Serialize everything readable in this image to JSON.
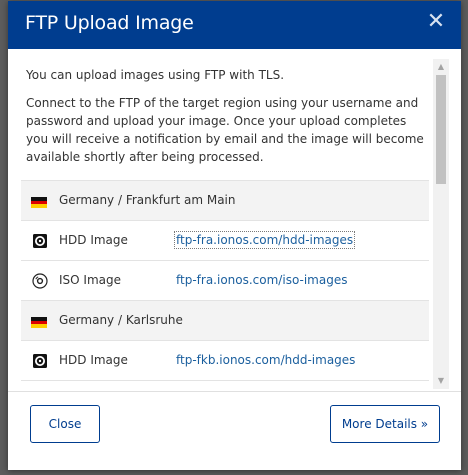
{
  "modal": {
    "title": "FTP Upload Image",
    "close_icon": "close-icon"
  },
  "body": {
    "intro": "You can upload images using FTP with TLS.",
    "description": "Connect to the FTP of the target region using your username and password and upload your image. Once your upload completes you will receive a notification by email and the image will become available shortly after being processed."
  },
  "regions": [
    {
      "name": "Germany / Frankfurt am Main",
      "flag": "germany-flag",
      "entries": [
        {
          "type_label": "HDD Image",
          "icon": "hdd-image-icon",
          "url": "ftp-fra.ionos.com/hdd-images",
          "focused": true
        },
        {
          "type_label": "ISO Image",
          "icon": "iso-image-icon",
          "url": "ftp-fra.ionos.com/iso-images",
          "focused": false
        }
      ]
    },
    {
      "name": "Germany / Karlsruhe",
      "flag": "germany-flag",
      "entries": [
        {
          "type_label": "HDD Image",
          "icon": "hdd-image-icon",
          "url": "ftp-fkb.ionos.com/hdd-images",
          "focused": false
        },
        {
          "type_label": "",
          "icon": "iso-image-icon",
          "url": "",
          "focused": false
        }
      ]
    }
  ],
  "scrollbar": {
    "up_icon": "scroll-up-arrow-icon",
    "down_icon": "scroll-down-arrow-icon"
  },
  "footer": {
    "close_label": "Close",
    "more_label": "More Details »"
  },
  "colors": {
    "header": "#003d8f",
    "link": "#1b5f9e",
    "button_border": "#003d8f",
    "backdrop": "#5c5c5c"
  }
}
